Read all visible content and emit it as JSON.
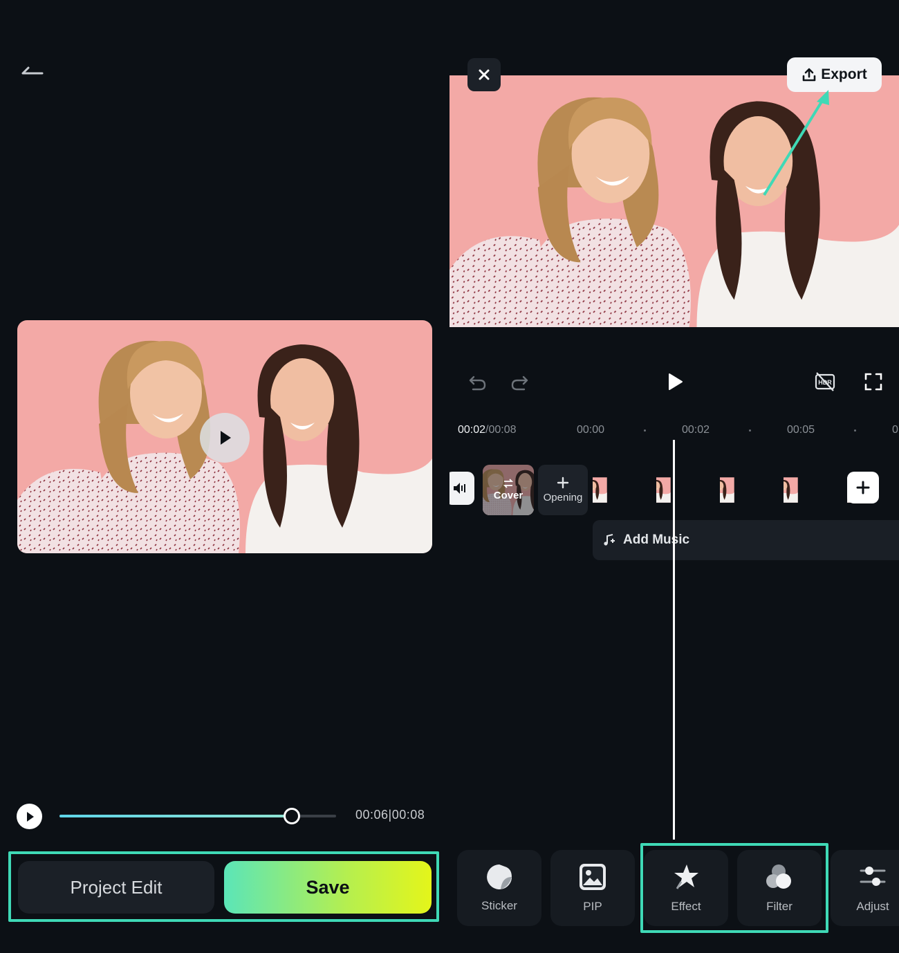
{
  "left": {
    "back_icon": "back-arrow-icon",
    "preview_play_icon": "play-icon",
    "playback": {
      "progress": 0.84,
      "time_label": "00:06|00:08"
    },
    "buttons": {
      "project_edit": "Project Edit",
      "save": "Save"
    }
  },
  "right": {
    "close_icon": "close-icon",
    "export_label": "Export",
    "export_icon": "upload-icon",
    "controls": [
      "undo-icon",
      "redo-icon",
      "play-icon",
      "hdr-off-icon",
      "fullscreen-icon"
    ],
    "ruler": {
      "current": "00:02",
      "total": "/00:08",
      "ticks": [
        "00:00",
        "00:02",
        "00:05",
        "0"
      ]
    },
    "track": {
      "cover_label": "Cover",
      "opening_label": "Opening",
      "add_music_label": "Add Music"
    },
    "toolbar": [
      {
        "label": "Sticker",
        "icon": "sticker-icon"
      },
      {
        "label": "PIP",
        "icon": "image-icon"
      },
      {
        "label": "Effect",
        "icon": "star-effect-icon"
      },
      {
        "label": "Filter",
        "icon": "filter-icon"
      },
      {
        "label": "Adjust",
        "icon": "sliders-icon"
      }
    ]
  },
  "colors": {
    "background": "#0c1015",
    "highlight": "#3fd9b6",
    "save_gradient_start": "#5be5b8",
    "save_gradient_end": "#e4f51a",
    "photo_background": "#f3a9a6"
  }
}
